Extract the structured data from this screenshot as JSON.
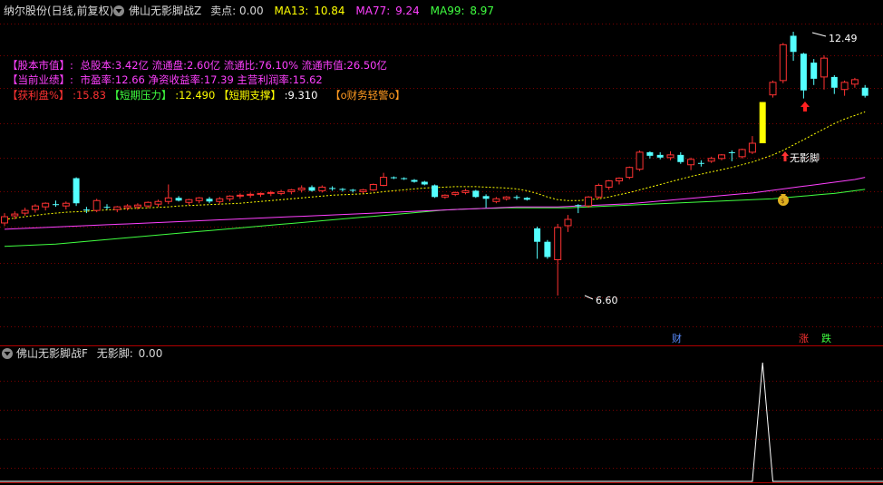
{
  "main_header": {
    "stock": "纳尔股份(日线,前复权)",
    "indicator": "佛山无影脚战Z",
    "sell_label": "卖点:",
    "sell_value": "0.00",
    "ma13_label": "MA13:",
    "ma13_value": "10.84",
    "ma77_label": "MA77:",
    "ma77_value": "9.24",
    "ma99_label": "MA99:",
    "ma99_value": "8.97"
  },
  "info": {
    "line1_tag": "【股本市值】:",
    "line1_text": "总股本:3.42亿 流通盘:2.60亿 流通比:76.10% 流通市值:26.50亿",
    "line2_tag": "【当前业绩】:",
    "line2_text": "市盈率:12.66 净资收益率:17.39 主营利润率:15.62",
    "line3_tag1": "【获利盘%】",
    "line3_val1": ":15.83",
    "line3_tag2": "【短期压力】",
    "line3_val2": ":12.490",
    "line3_tag3": "【短期支撑】",
    "line3_val3": ":9.310",
    "line3_tag4": "【o财务轻警o】"
  },
  "annotations": {
    "high_label": "12.49",
    "low_label": "6.60",
    "signal_label": "无影脚",
    "finance_marker": "财",
    "up_marker": "涨",
    "down_marker": "跌"
  },
  "sub_header": {
    "indicator": "佛山无影脚战F",
    "value_label": "无影脚:",
    "value": "0.00"
  },
  "colors": {
    "up": "#ff3232",
    "down": "#54ffff",
    "ma13": "#ffff00",
    "ma77": "#ff40ff",
    "ma99": "#40ff40",
    "grid": "#7a0000",
    "signal_bar": "#ffff00"
  },
  "chart_data": [
    {
      "type": "candlestick",
      "title": "纳尔股份(日线,前复权)",
      "ylim": [
        6.0,
        13.0
      ],
      "series": [
        {
          "name": "K",
          "ohlc": [
            [
              8.22,
              8.44,
              8.15,
              8.36
            ],
            [
              8.38,
              8.48,
              8.3,
              8.42
            ],
            [
              8.44,
              8.56,
              8.38,
              8.5
            ],
            [
              8.52,
              8.64,
              8.45,
              8.6
            ],
            [
              8.58,
              8.68,
              8.5,
              8.66
            ],
            [
              8.64,
              8.72,
              8.58,
              8.62
            ],
            [
              8.6,
              8.7,
              8.52,
              8.66
            ],
            [
              9.22,
              9.24,
              8.6,
              8.66
            ],
            [
              8.52,
              8.58,
              8.44,
              8.5
            ],
            [
              8.5,
              8.76,
              8.46,
              8.72
            ],
            [
              8.58,
              8.64,
              8.52,
              8.56
            ],
            [
              8.52,
              8.6,
              8.46,
              8.58
            ],
            [
              8.56,
              8.64,
              8.5,
              8.6
            ],
            [
              8.58,
              8.66,
              8.52,
              8.62
            ],
            [
              8.6,
              8.7,
              8.55,
              8.68
            ],
            [
              8.64,
              8.74,
              8.58,
              8.7
            ],
            [
              8.7,
              9.08,
              8.64,
              8.78
            ],
            [
              8.78,
              8.82,
              8.7,
              8.72
            ],
            [
              8.68,
              8.76,
              8.62,
              8.74
            ],
            [
              8.72,
              8.8,
              8.66,
              8.78
            ],
            [
              8.76,
              8.8,
              8.66,
              8.7
            ],
            [
              8.7,
              8.8,
              8.64,
              8.76
            ],
            [
              8.76,
              8.84,
              8.7,
              8.82
            ],
            [
              8.82,
              8.88,
              8.76,
              8.84
            ],
            [
              8.84,
              8.9,
              8.78,
              8.86
            ],
            [
              8.86,
              8.9,
              8.8,
              8.88
            ],
            [
              8.88,
              8.94,
              8.82,
              8.9
            ],
            [
              8.88,
              8.96,
              8.84,
              8.92
            ],
            [
              8.92,
              8.98,
              8.86,
              8.96
            ],
            [
              8.96,
              9.06,
              8.9,
              9.0
            ],
            [
              9.02,
              9.06,
              8.92,
              8.94
            ],
            [
              8.94,
              9.06,
              8.9,
              9.02
            ],
            [
              9.0,
              9.04,
              8.94,
              8.98
            ],
            [
              8.98,
              9.0,
              8.92,
              8.96
            ],
            [
              8.96,
              8.98,
              8.9,
              8.94
            ],
            [
              8.92,
              8.98,
              8.88,
              8.96
            ],
            [
              8.96,
              9.1,
              8.94,
              9.08
            ],
            [
              9.06,
              9.34,
              9.04,
              9.24
            ],
            [
              9.24,
              9.26,
              9.2,
              9.22
            ],
            [
              9.22,
              9.24,
              9.18,
              9.2
            ],
            [
              9.18,
              9.2,
              9.12,
              9.14
            ],
            [
              9.14,
              9.16,
              9.06,
              9.08
            ],
            [
              9.06,
              9.08,
              8.78,
              8.8
            ],
            [
              8.8,
              8.86,
              8.76,
              8.84
            ],
            [
              8.86,
              8.92,
              8.82,
              8.9
            ],
            [
              8.9,
              8.98,
              8.86,
              8.94
            ],
            [
              8.94,
              8.96,
              8.78,
              8.8
            ],
            [
              8.82,
              8.86,
              8.56,
              8.76
            ],
            [
              8.7,
              8.8,
              8.66,
              8.76
            ],
            [
              8.76,
              8.82,
              8.72,
              8.8
            ],
            [
              8.8,
              8.84,
              8.74,
              8.78
            ],
            [
              8.78,
              8.8,
              8.72,
              8.74
            ],
            [
              8.1,
              8.14,
              7.42,
              7.8
            ],
            [
              7.8,
              7.84,
              7.42,
              7.46
            ],
            [
              7.4,
              8.2,
              6.6,
              8.12
            ],
            [
              8.16,
              8.4,
              8.02,
              8.3
            ],
            [
              8.62,
              8.64,
              8.44,
              8.6
            ],
            [
              8.6,
              8.82,
              8.56,
              8.8
            ],
            [
              8.8,
              9.1,
              8.76,
              9.06
            ],
            [
              9.02,
              9.18,
              8.96,
              9.16
            ],
            [
              9.16,
              9.24,
              9.08,
              9.22
            ],
            [
              9.24,
              9.48,
              9.2,
              9.46
            ],
            [
              9.42,
              9.84,
              9.38,
              9.8
            ],
            [
              9.8,
              9.82,
              9.66,
              9.72
            ],
            [
              9.74,
              9.8,
              9.64,
              9.68
            ],
            [
              9.68,
              9.82,
              9.62,
              9.74
            ],
            [
              9.74,
              9.8,
              9.54,
              9.58
            ],
            [
              9.52,
              9.68,
              9.4,
              9.64
            ],
            [
              9.56,
              9.62,
              9.48,
              9.54
            ],
            [
              9.6,
              9.7,
              9.56,
              9.66
            ],
            [
              9.66,
              9.76,
              9.62,
              9.74
            ],
            [
              9.8,
              9.84,
              9.6,
              9.78
            ],
            [
              9.7,
              9.88,
              9.66,
              9.86
            ],
            [
              9.8,
              10.16,
              9.76,
              10.0
            ],
            [
              10.0,
              10.92,
              10.0,
              10.92
            ],
            [
              11.08,
              11.4,
              11.02,
              11.36
            ],
            [
              11.4,
              12.24,
              11.34,
              12.2
            ],
            [
              12.4,
              12.49,
              11.84,
              12.04
            ],
            [
              12.0,
              12.02,
              11.0,
              11.18
            ],
            [
              11.8,
              11.88,
              11.3,
              11.44
            ],
            [
              11.48,
              11.96,
              11.2,
              11.9
            ],
            [
              11.48,
              11.52,
              11.1,
              11.24
            ],
            [
              11.2,
              11.4,
              11.06,
              11.36
            ],
            [
              11.32,
              11.46,
              11.24,
              11.42
            ],
            [
              11.24,
              11.3,
              11.02,
              11.06
            ]
          ]
        },
        {
          "name": "MA13",
          "values": [
            8.3,
            8.33,
            8.36,
            8.39,
            8.42,
            8.44,
            8.46,
            8.47,
            8.48,
            8.5,
            8.51,
            8.52,
            8.54,
            8.55,
            8.56,
            8.57,
            8.58,
            8.6,
            8.61,
            8.62,
            8.63,
            8.64,
            8.65,
            8.66,
            8.68,
            8.7,
            8.72,
            8.74,
            8.76,
            8.78,
            8.8,
            8.82,
            8.84,
            8.85,
            8.86,
            8.87,
            8.89,
            8.92,
            8.94,
            8.96,
            8.98,
            9.0,
            9.01,
            9.02,
            9.03,
            9.03,
            9.03,
            9.02,
            9.01,
            9.0,
            8.98,
            8.94,
            8.88,
            8.8,
            8.74,
            8.72,
            8.72,
            8.74,
            8.76,
            8.8,
            8.85,
            8.9,
            8.96,
            9.02,
            9.08,
            9.14,
            9.2,
            9.26,
            9.31,
            9.36,
            9.41,
            9.46,
            9.52,
            9.58,
            9.66,
            9.74,
            9.84,
            9.96,
            10.08,
            10.2,
            10.32,
            10.44,
            10.54,
            10.62,
            10.7
          ]
        },
        {
          "name": "MA77",
          "values": [
            8.08,
            8.09,
            8.1,
            8.11,
            8.12,
            8.13,
            8.14,
            8.15,
            8.16,
            8.17,
            8.18,
            8.19,
            8.2,
            8.21,
            8.22,
            8.23,
            8.24,
            8.25,
            8.26,
            8.27,
            8.28,
            8.29,
            8.3,
            8.31,
            8.32,
            8.33,
            8.34,
            8.35,
            8.36,
            8.37,
            8.38,
            8.39,
            8.4,
            8.41,
            8.42,
            8.43,
            8.44,
            8.45,
            8.46,
            8.47,
            8.48,
            8.49,
            8.5,
            8.51,
            8.52,
            8.53,
            8.54,
            8.55,
            8.56,
            8.57,
            8.58,
            8.58,
            8.58,
            8.58,
            8.58,
            8.59,
            8.6,
            8.61,
            8.62,
            8.63,
            8.64,
            8.65,
            8.67,
            8.69,
            8.71,
            8.73,
            8.75,
            8.77,
            8.79,
            8.81,
            8.83,
            8.85,
            8.87,
            8.89,
            8.92,
            8.95,
            8.98,
            9.01,
            9.04,
            9.07,
            9.1,
            9.13,
            9.16,
            9.19,
            9.24
          ]
        },
        {
          "name": "MA99",
          "values": [
            7.7,
            7.71,
            7.72,
            7.73,
            7.74,
            7.75,
            7.77,
            7.79,
            7.81,
            7.83,
            7.85,
            7.87,
            7.89,
            7.91,
            7.93,
            7.95,
            7.97,
            7.99,
            8.01,
            8.03,
            8.05,
            8.07,
            8.09,
            8.11,
            8.13,
            8.15,
            8.17,
            8.19,
            8.21,
            8.23,
            8.25,
            8.27,
            8.29,
            8.31,
            8.33,
            8.35,
            8.37,
            8.39,
            8.41,
            8.43,
            8.45,
            8.47,
            8.49,
            8.51,
            8.52,
            8.53,
            8.54,
            8.55,
            8.55,
            8.56,
            8.56,
            8.56,
            8.56,
            8.56,
            8.56,
            8.56,
            8.57,
            8.58,
            8.59,
            8.6,
            8.61,
            8.62,
            8.63,
            8.64,
            8.65,
            8.66,
            8.67,
            8.68,
            8.69,
            8.7,
            8.71,
            8.72,
            8.73,
            8.74,
            8.75,
            8.76,
            8.78,
            8.8,
            8.82,
            8.84,
            8.86,
            8.88,
            8.91,
            8.94,
            8.97
          ]
        }
      ]
    },
    {
      "type": "line",
      "title": "佛山无影脚战F",
      "series": [
        {
          "name": "无影脚",
          "values": [
            0,
            0,
            0,
            0,
            0,
            0,
            0,
            0,
            0,
            0,
            0,
            0,
            0,
            0,
            0,
            0,
            0,
            0,
            0,
            0,
            0,
            0,
            0,
            0,
            0,
            0,
            0,
            0,
            0,
            0,
            0,
            0,
            0,
            0,
            0,
            0,
            0,
            0,
            0,
            0,
            0,
            0,
            0,
            0,
            0,
            0,
            0,
            0,
            0,
            0,
            0,
            0,
            0,
            0,
            0,
            0,
            0,
            0,
            0,
            0,
            0,
            0,
            0,
            0,
            0,
            0,
            0,
            0,
            0,
            0,
            0,
            0,
            0,
            0,
            1,
            0,
            0,
            0,
            0,
            0,
            0,
            0,
            0,
            0,
            0
          ]
        }
      ]
    }
  ]
}
